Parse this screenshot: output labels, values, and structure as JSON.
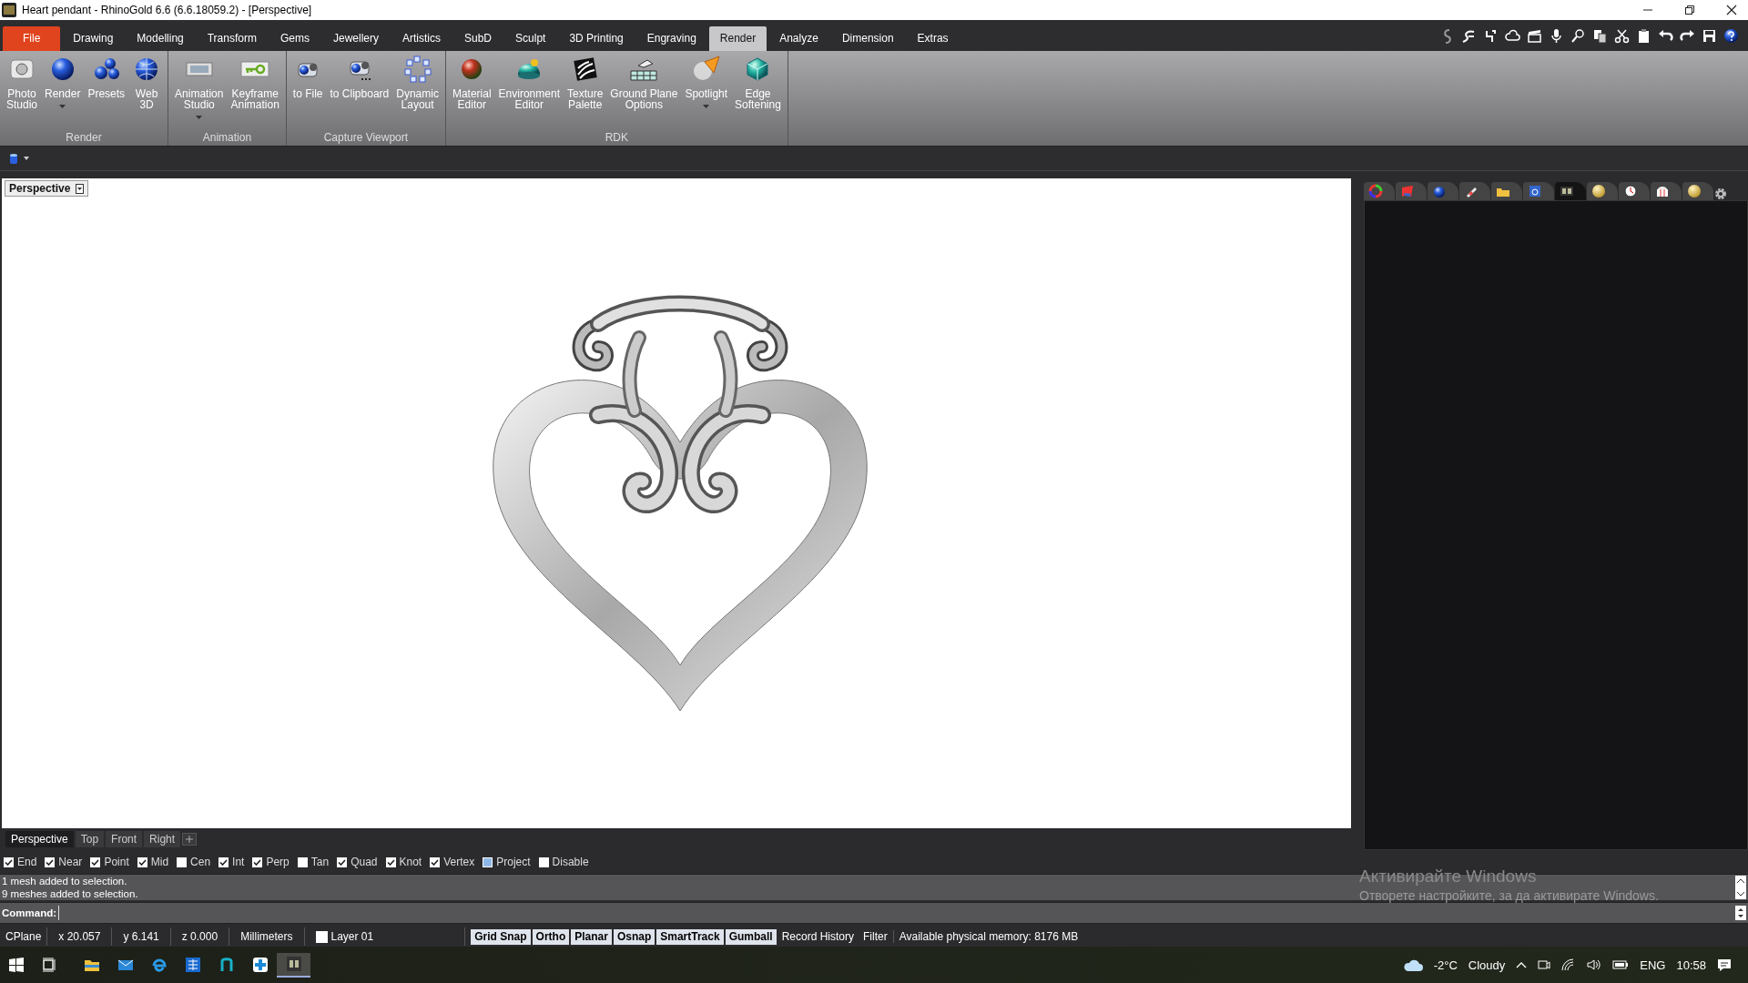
{
  "window": {
    "title": "Heart pendant - RhinoGold 6.6 (6.6.18059.2) - [Perspective]"
  },
  "menu_tabs": [
    {
      "label": "File",
      "kind": "file",
      "selected": false
    },
    {
      "label": "Drawing",
      "kind": "tab",
      "selected": false
    },
    {
      "label": "Modelling",
      "kind": "tab",
      "selected": false
    },
    {
      "label": "Transform",
      "kind": "tab",
      "selected": false
    },
    {
      "label": "Gems",
      "kind": "tab",
      "selected": false
    },
    {
      "label": "Jewellery",
      "kind": "tab",
      "selected": false
    },
    {
      "label": "Artistics",
      "kind": "tab",
      "selected": false
    },
    {
      "label": "SubD",
      "kind": "tab",
      "selected": false
    },
    {
      "label": "Sculpt",
      "kind": "tab",
      "selected": false
    },
    {
      "label": "3D Printing",
      "kind": "tab",
      "selected": false
    },
    {
      "label": "Engraving",
      "kind": "tab",
      "selected": false
    },
    {
      "label": "Render",
      "kind": "tab",
      "selected": true
    },
    {
      "label": "Analyze",
      "kind": "tab",
      "selected": false
    },
    {
      "label": "Dimension",
      "kind": "tab",
      "selected": false
    },
    {
      "label": "Extras",
      "kind": "tab",
      "selected": false
    }
  ],
  "ribbon": {
    "groups": [
      {
        "label": "Render",
        "buttons": [
          {
            "label": "Photo\nStudio",
            "dropdown": false
          },
          {
            "label": "Render",
            "dropdown": true
          },
          {
            "label": "Presets",
            "dropdown": false
          },
          {
            "label": "Web\n3D",
            "dropdown": false
          }
        ]
      },
      {
        "label": "Animation",
        "buttons": [
          {
            "label": "Animation\nStudio",
            "dropdown": true
          },
          {
            "label": "Keyframe\nAnimation",
            "dropdown": false
          }
        ]
      },
      {
        "label": "Capture Viewport",
        "buttons": [
          {
            "label": "to File",
            "dropdown": false
          },
          {
            "label": "to Clipboard",
            "dropdown": false
          },
          {
            "label": "Dynamic\nLayout",
            "dropdown": false
          }
        ]
      },
      {
        "label": "RDK",
        "buttons": [
          {
            "label": "Material\nEditor",
            "dropdown": false
          },
          {
            "label": "Environment\nEditor",
            "dropdown": false
          },
          {
            "label": "Texture\nPalette",
            "dropdown": false
          },
          {
            "label": "Ground Plane\nOptions",
            "dropdown": false
          },
          {
            "label": "Spotlight",
            "dropdown": true
          },
          {
            "label": "Edge\nSoftening",
            "dropdown": false
          }
        ]
      }
    ]
  },
  "viewport": {
    "title": "Perspective"
  },
  "viewport_tabs": [
    {
      "label": "Perspective",
      "selected": true
    },
    {
      "label": "Top",
      "selected": false
    },
    {
      "label": "Front",
      "selected": false
    },
    {
      "label": "Right",
      "selected": false
    }
  ],
  "panel_tabs": [
    {
      "selected": false
    },
    {
      "selected": false
    },
    {
      "selected": false
    },
    {
      "selected": false
    },
    {
      "selected": false
    },
    {
      "selected": false
    },
    {
      "selected": true
    },
    {
      "selected": false
    },
    {
      "selected": false
    },
    {
      "selected": false
    },
    {
      "selected": false
    }
  ],
  "osnaps": [
    {
      "label": "End",
      "kind": "checkbox",
      "checked": true
    },
    {
      "label": "Near",
      "kind": "checkbox",
      "checked": true
    },
    {
      "label": "Point",
      "kind": "checkbox",
      "checked": true
    },
    {
      "label": "Mid",
      "kind": "checkbox",
      "checked": true
    },
    {
      "label": "Cen",
      "kind": "checkbox",
      "checked": false
    },
    {
      "label": "Int",
      "kind": "checkbox",
      "checked": true
    },
    {
      "label": "Perp",
      "kind": "checkbox",
      "checked": true
    },
    {
      "label": "Tan",
      "kind": "checkbox",
      "checked": false
    },
    {
      "label": "Quad",
      "kind": "checkbox",
      "checked": true
    },
    {
      "label": "Knot",
      "kind": "checkbox",
      "checked": true
    },
    {
      "label": "Vertex",
      "kind": "checkbox",
      "checked": true
    },
    {
      "label": "Project",
      "kind": "indeterminate",
      "checked": false
    },
    {
      "label": "Disable",
      "kind": "checkbox",
      "checked": false
    }
  ],
  "command_history": [
    "1 mesh added to selection.",
    "9 meshes added to selection."
  ],
  "command": {
    "label": "Command:"
  },
  "status_bar": {
    "cells": [
      "CPlane",
      "x 20.057",
      "y 6.141",
      "z 0.000",
      "Millimeters"
    ],
    "layer": {
      "label": "Layer 01",
      "color": "#ffffff"
    },
    "toggles": [
      {
        "label": "Grid Snap",
        "on": true
      },
      {
        "label": "Ortho",
        "on": true
      },
      {
        "label": "Planar",
        "on": true
      },
      {
        "label": "Osnap",
        "on": true
      },
      {
        "label": "SmartTrack",
        "on": true
      },
      {
        "label": "Gumball",
        "on": true
      },
      {
        "label": "Record History",
        "on": false
      },
      {
        "label": "Filter",
        "on": false
      }
    ],
    "memory": "Available physical memory: 8176 MB"
  },
  "activation": {
    "title": "Активирайте Windows",
    "text": "Отворете настройките, за да активирате Windows."
  },
  "taskbar": {
    "apps": [
      {
        "active": false
      },
      {
        "active": false
      },
      {
        "active": false
      },
      {
        "active": false
      },
      {
        "active": false
      },
      {
        "active": false
      },
      {
        "active": true
      }
    ],
    "weather": {
      "temperature": "-2°C",
      "condition": "Cloudy"
    },
    "language": "ENG",
    "time": "10:58"
  }
}
